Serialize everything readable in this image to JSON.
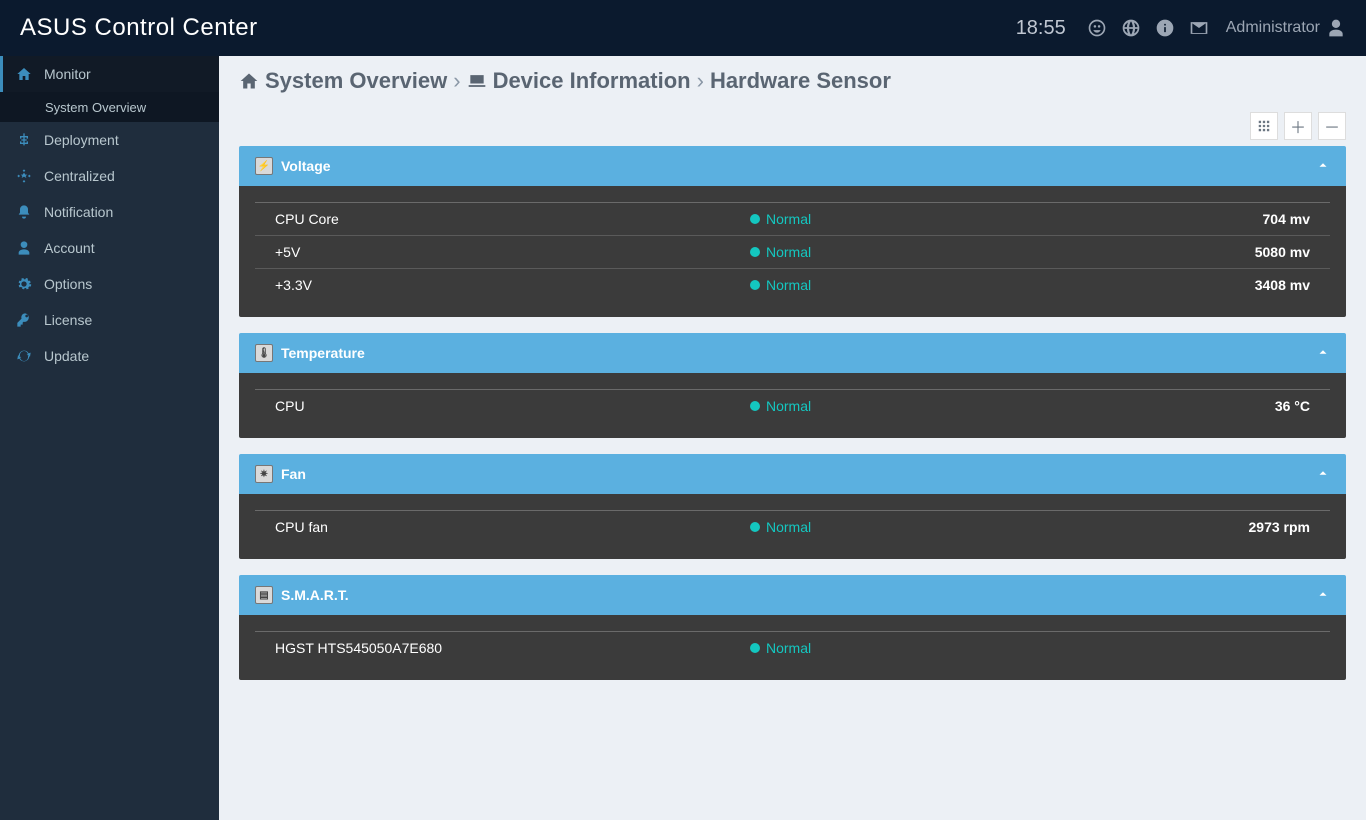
{
  "header": {
    "brand_html": "ASUS Control Center",
    "time": "18:55",
    "user": "Administrator"
  },
  "sidebar": [
    {
      "id": "monitor",
      "label": "Monitor",
      "active": true,
      "sub": [
        {
          "id": "sysov",
          "label": "System Overview"
        }
      ]
    },
    {
      "id": "deployment",
      "label": "Deployment"
    },
    {
      "id": "centralized",
      "label": "Centralized"
    },
    {
      "id": "notification",
      "label": "Notification"
    },
    {
      "id": "account",
      "label": "Account"
    },
    {
      "id": "options",
      "label": "Options"
    },
    {
      "id": "license",
      "label": "License"
    },
    {
      "id": "update",
      "label": "Update"
    }
  ],
  "breadcrumb": {
    "a": "System Overview",
    "b": "Device Information",
    "c": "Hardware Sensor"
  },
  "panels": {
    "voltage": {
      "title": "Voltage",
      "rows": [
        {
          "name": "CPU Core",
          "status": "Normal",
          "value": "704 mv"
        },
        {
          "name": "+5V",
          "status": "Normal",
          "value": "5080 mv"
        },
        {
          "name": "+3.3V",
          "status": "Normal",
          "value": "3408 mv"
        }
      ]
    },
    "temperature": {
      "title": "Temperature",
      "rows": [
        {
          "name": "CPU",
          "status": "Normal",
          "value": "36 °C"
        }
      ]
    },
    "fan": {
      "title": "Fan",
      "rows": [
        {
          "name": "CPU fan",
          "status": "Normal",
          "value": "2973 rpm"
        }
      ]
    },
    "smart": {
      "title": "S.M.A.R.T.",
      "rows": [
        {
          "name": "HGST HTS545050A7E680",
          "status": "Normal",
          "value": ""
        }
      ]
    }
  }
}
